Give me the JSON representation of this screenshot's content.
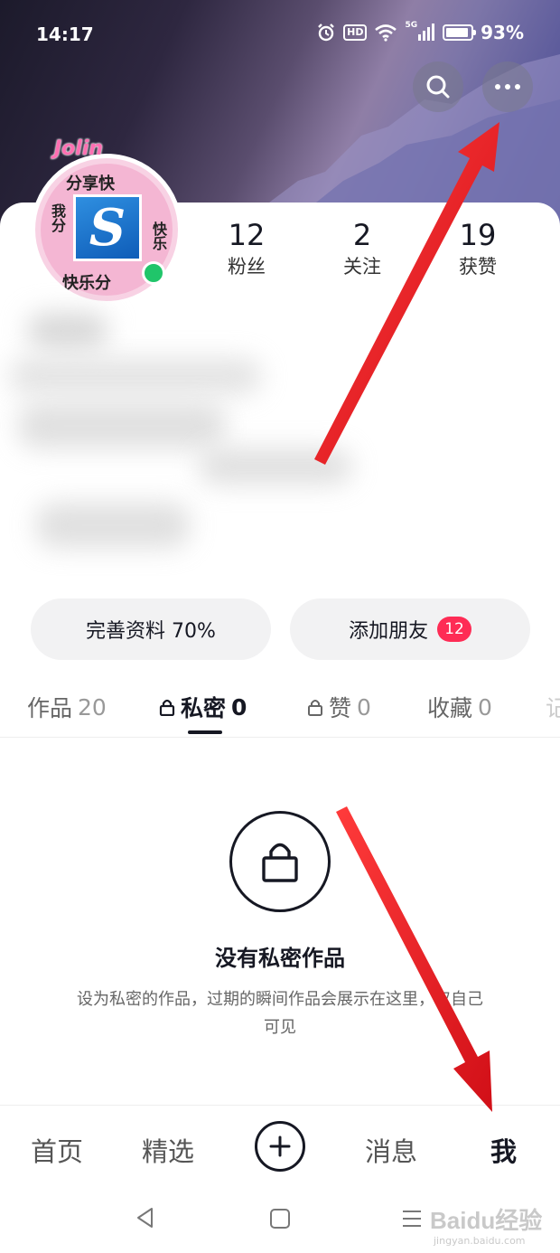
{
  "status_bar": {
    "time": "14:17",
    "hd_label": "HD",
    "network_label": "5G",
    "battery": "93%"
  },
  "header": {
    "search_icon": "search-icon",
    "more_icon": "more-horizontal-icon"
  },
  "profile": {
    "avatar_brand": "Jolin",
    "avatar_text_top": "分享快",
    "avatar_text_left": "我分",
    "avatar_text_right": "快乐",
    "avatar_text_bottom": "快乐分",
    "avatar_logo": "S",
    "online_status_color": "#20c56a"
  },
  "stats": [
    {
      "value": "12",
      "label": "粉丝"
    },
    {
      "value": "2",
      "label": "关注"
    },
    {
      "value": "19",
      "label": "获赞"
    }
  ],
  "actions": {
    "complete_profile": "完善资料 70%",
    "add_friends": "添加朋友",
    "add_friends_badge": "12"
  },
  "tabs": [
    {
      "label": "作品",
      "count": "20",
      "locked": false
    },
    {
      "label": "私密",
      "count": "0",
      "locked": true,
      "active": true
    },
    {
      "label": "赞",
      "count": "0",
      "locked": true
    },
    {
      "label": "收藏",
      "count": "0",
      "locked": false
    },
    {
      "label": "记",
      "count": "",
      "locked": false
    }
  ],
  "empty_state": {
    "title": "没有私密作品",
    "description": "设为私密的作品，过期的瞬间作品会展示在这里，仅自己可见"
  },
  "bottom_nav": [
    {
      "label": "首页"
    },
    {
      "label": "精选"
    },
    {
      "label": "消息"
    },
    {
      "label": "我",
      "active": true
    }
  ],
  "watermark": {
    "text": "Baidu经验",
    "sub": "jingyan.baidu.com"
  },
  "colors": {
    "accent": "#fe2c55",
    "arrow": "#e8141e",
    "text_primary": "#161823"
  }
}
